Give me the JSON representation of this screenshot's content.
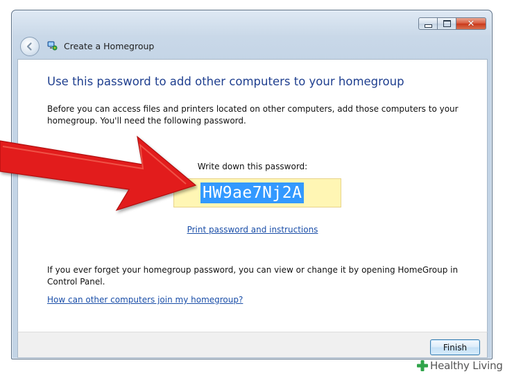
{
  "window": {
    "title": "Create a Homegroup",
    "controls": [
      "minimize-icon",
      "maximize-icon",
      "close-icon"
    ],
    "close_glyph": "✕"
  },
  "content": {
    "heading": "Use this password to add other computers to your homegroup",
    "intro": "Before you can access files and printers located on other computers, add those computers to your homegroup. You'll need the following password.",
    "password_label": "Write down this password:",
    "password": "HW9ae7Nj2A",
    "print_link": "Print password and instructions",
    "forget_text": "If you ever forget your homegroup password, you can view or change it by opening HomeGroup in Control Panel.",
    "join_link": "How can other computers join my homegroup?"
  },
  "footer": {
    "finish_label": "Finish"
  },
  "watermark": {
    "text": "Healthy Living"
  },
  "colors": {
    "heading": "#1f3f8f",
    "link": "#1a4ea8",
    "selection": "#3399ff",
    "password_bg": "#fff6b4",
    "arrow": "#e21f1f",
    "watermark_plus": "#2fa44a"
  }
}
